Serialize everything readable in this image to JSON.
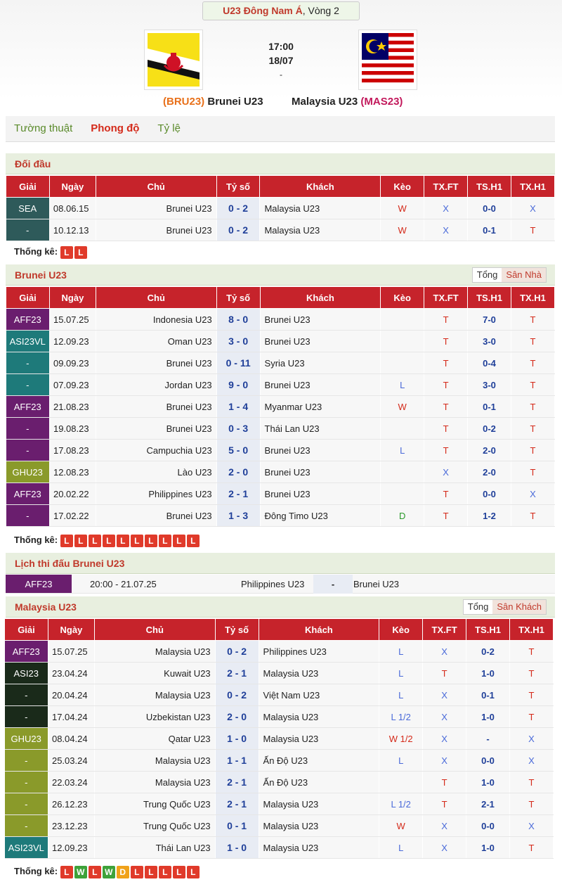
{
  "header": {
    "league": "U23 Đông Nam Á",
    "round": ", Vòng 2",
    "time": "17:00",
    "date": "18/07",
    "dash": "-",
    "home_code": "(BRU23)",
    "home_name": "Brunei U23",
    "away_name": "Malaysia U23",
    "away_code": "(MAS23)"
  },
  "tabs": [
    "Tường thuật",
    "Phong độ",
    "Tỷ lệ"
  ],
  "columns": [
    "Giải",
    "Ngày",
    "Chủ",
    "Tỷ số",
    "Khách",
    "Kèo",
    "TX.FT",
    "TS.H1",
    "TX.H1"
  ],
  "h2h": {
    "title": "Đối đầu",
    "stat_label": "Thống kê:",
    "stats": [
      "L",
      "L"
    ],
    "rows": [
      {
        "league": "SEA",
        "color": "#2e5a5a",
        "date": "08.06.15",
        "home": "Brunei U23",
        "score": "0 - 2",
        "away": "Malaysia U23",
        "keo": "W",
        "txft": "X",
        "h1": "0-0",
        "txh1": "X"
      },
      {
        "league": "-",
        "color": "#2e5a5a",
        "date": "10.12.13",
        "home": "Brunei U23",
        "score": "0 - 2",
        "away": "Malaysia U23",
        "keo": "W",
        "txft": "X",
        "h1": "0-1",
        "txh1": "T"
      }
    ]
  },
  "brunei": {
    "title": "Brunei U23",
    "filter": [
      "Tổng",
      "Sân Nhà"
    ],
    "stat_label": "Thống kê:",
    "stats": [
      "L",
      "L",
      "L",
      "L",
      "L",
      "L",
      "L",
      "L",
      "L",
      "L"
    ],
    "rows": [
      {
        "league": "AFF23",
        "color": "#6a1e6e",
        "date": "15.07.25",
        "home": "Indonesia U23",
        "score": "8 - 0",
        "away": "Brunei U23",
        "keo": "",
        "txft": "T",
        "h1": "7-0",
        "txh1": "T"
      },
      {
        "league": "ASI23VL",
        "color": "#1e7a7a",
        "date": "12.09.23",
        "home": "Oman U23",
        "score": "3 - 0",
        "away": "Brunei U23",
        "keo": "",
        "txft": "T",
        "h1": "3-0",
        "txh1": "T"
      },
      {
        "league": "-",
        "color": "#1e7a7a",
        "date": "09.09.23",
        "home": "Brunei U23",
        "score": "0 - 11",
        "away": "Syria U23",
        "keo": "",
        "txft": "T",
        "h1": "0-4",
        "txh1": "T"
      },
      {
        "league": "-",
        "color": "#1e7a7a",
        "date": "07.09.23",
        "home": "Jordan U23",
        "score": "9 - 0",
        "away": "Brunei U23",
        "keo": "L",
        "txft": "T",
        "h1": "3-0",
        "txh1": "T"
      },
      {
        "league": "AFF23",
        "color": "#6a1e6e",
        "date": "21.08.23",
        "home": "Brunei U23",
        "score": "1 - 4",
        "away": "Myanmar U23",
        "keo": "W",
        "txft": "T",
        "h1": "0-1",
        "txh1": "T"
      },
      {
        "league": "-",
        "color": "#6a1e6e",
        "date": "19.08.23",
        "home": "Brunei U23",
        "score": "0 - 3",
        "away": "Thái Lan U23",
        "keo": "",
        "txft": "T",
        "h1": "0-2",
        "txh1": "T"
      },
      {
        "league": "-",
        "color": "#6a1e6e",
        "date": "17.08.23",
        "home": "Campuchia U23",
        "score": "5 - 0",
        "away": "Brunei U23",
        "keo": "L",
        "txft": "T",
        "h1": "2-0",
        "txh1": "T"
      },
      {
        "league": "GHU23",
        "color": "#8a9a2a",
        "date": "12.08.23",
        "home": "Lào U23",
        "score": "2 - 0",
        "away": "Brunei U23",
        "keo": "",
        "txft": "X",
        "h1": "2-0",
        "txh1": "T"
      },
      {
        "league": "AFF23",
        "color": "#6a1e6e",
        "date": "20.02.22",
        "home": "Philippines U23",
        "score": "2 - 1",
        "away": "Brunei U23",
        "keo": "",
        "txft": "T",
        "h1": "0-0",
        "txh1": "X"
      },
      {
        "league": "-",
        "color": "#6a1e6e",
        "date": "17.02.22",
        "home": "Brunei U23",
        "score": "1 - 3",
        "away": "Đông Timo U23",
        "keo": "D",
        "txft": "T",
        "h1": "1-2",
        "txh1": "T"
      }
    ]
  },
  "fixtures": {
    "title": "Lịch thi đấu Brunei U23",
    "league": "AFF23",
    "color": "#6a1e6e",
    "datetime": "20:00 - 21.07.25",
    "home": "Philippines U23",
    "sep": "-",
    "away": "Brunei U23"
  },
  "malaysia": {
    "title": "Malaysia U23",
    "filter": [
      "Tổng",
      "Sân Khách"
    ],
    "stat_label": "Thống kê:",
    "stats": [
      "L",
      "W",
      "L",
      "W",
      "D",
      "L",
      "L",
      "L",
      "L",
      "L"
    ],
    "rows": [
      {
        "league": "AFF23",
        "color": "#6a1e6e",
        "date": "15.07.25",
        "home": "Malaysia U23",
        "score": "0 - 2",
        "away": "Philippines U23",
        "keo": "L",
        "txft": "X",
        "h1": "0-2",
        "txh1": "T"
      },
      {
        "league": "ASI23",
        "color": "#1a2a1a",
        "date": "23.04.24",
        "home": "Kuwait U23",
        "score": "2 - 1",
        "away": "Malaysia U23",
        "keo": "L",
        "txft": "T",
        "h1": "1-0",
        "txh1": "T"
      },
      {
        "league": "-",
        "color": "#1a2a1a",
        "date": "20.04.24",
        "home": "Malaysia U23",
        "score": "0 - 2",
        "away": "Việt Nam U23",
        "keo": "L",
        "txft": "X",
        "h1": "0-1",
        "txh1": "T"
      },
      {
        "league": "-",
        "color": "#1a2a1a",
        "date": "17.04.24",
        "home": "Uzbekistan U23",
        "score": "2 - 0",
        "away": "Malaysia U23",
        "keo": "L 1/2",
        "txft": "X",
        "h1": "1-0",
        "txh1": "T"
      },
      {
        "league": "GHU23",
        "color": "#8a9a2a",
        "date": "08.04.24",
        "home": "Qatar U23",
        "score": "1 - 0",
        "away": "Malaysia U23",
        "keo": "W 1/2",
        "txft": "X",
        "h1": "-",
        "txh1": "X"
      },
      {
        "league": "-",
        "color": "#8a9a2a",
        "date": "25.03.24",
        "home": "Malaysia U23",
        "score": "1 - 1",
        "away": "Ấn Độ U23",
        "keo": "L",
        "txft": "X",
        "h1": "0-0",
        "txh1": "X"
      },
      {
        "league": "-",
        "color": "#8a9a2a",
        "date": "22.03.24",
        "home": "Malaysia U23",
        "score": "2 - 1",
        "away": "Ấn Độ U23",
        "keo": "",
        "txft": "T",
        "h1": "1-0",
        "txh1": "T"
      },
      {
        "league": "-",
        "color": "#8a9a2a",
        "date": "26.12.23",
        "home": "Trung Quốc U23",
        "score": "2 - 1",
        "away": "Malaysia U23",
        "keo": "L 1/2",
        "txft": "T",
        "h1": "2-1",
        "txh1": "T"
      },
      {
        "league": "-",
        "color": "#8a9a2a",
        "date": "23.12.23",
        "home": "Trung Quốc U23",
        "score": "0 - 1",
        "away": "Malaysia U23",
        "keo": "W",
        "txft": "X",
        "h1": "0-0",
        "txh1": "X"
      },
      {
        "league": "ASI23VL",
        "color": "#1e7a7a",
        "date": "12.09.23",
        "home": "Thái Lan U23",
        "score": "1 - 0",
        "away": "Malaysia U23",
        "keo": "L",
        "txft": "X",
        "h1": "1-0",
        "txh1": "T"
      }
    ]
  }
}
